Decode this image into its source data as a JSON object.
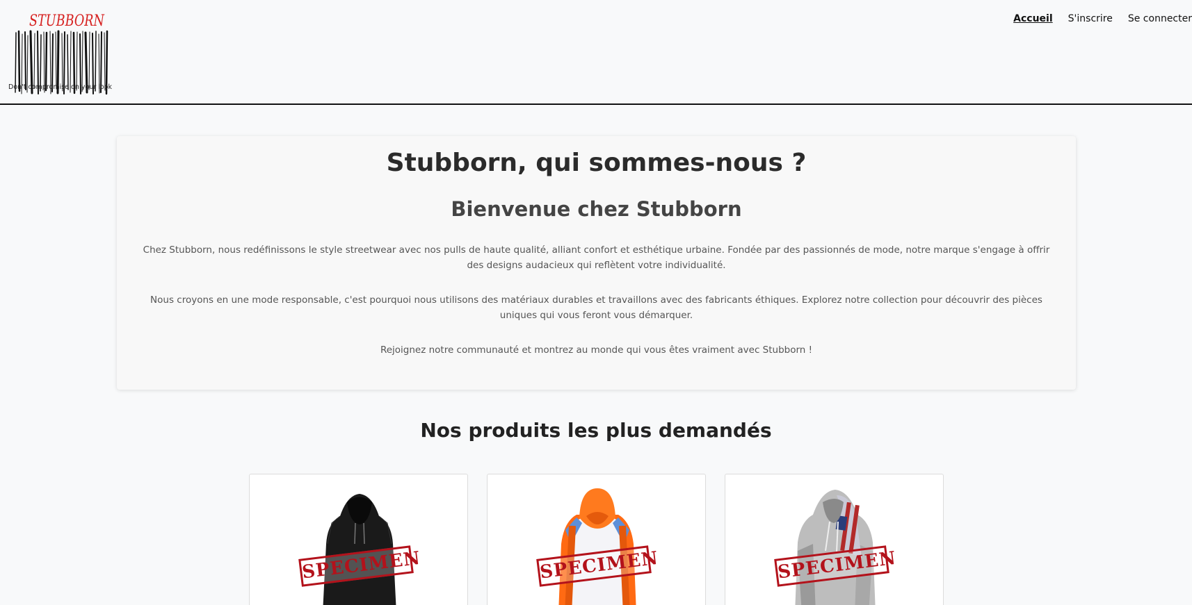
{
  "header": {
    "logo_text": "STUBBORN",
    "tagline": "Don't compromise on your look",
    "nav": [
      {
        "label": "Accueil",
        "active": true
      },
      {
        "label": "S'inscrire",
        "active": false
      },
      {
        "label": "Se connecter",
        "active": false
      }
    ]
  },
  "about": {
    "title": "Stubborn, qui sommes-nous ?",
    "subtitle": "Bienvenue chez Stubborn",
    "paragraphs": [
      "Chez Stubborn, nous redéfinissons le style streetwear avec nos pulls de haute qualité, alliant confort et esthétique urbaine. Fondée par des passionnés de mode, notre marque s'engage à offrir des designs audacieux qui reflètent votre individualité.",
      "Nous croyons en une mode responsable, c'est pourquoi nous utilisons des matériaux durables et travaillons avec des fabricants éthiques. Explorez notre collection pour découvrir des pièces uniques qui vous feront vous démarquer.",
      "Rejoignez notre communauté et montrez au monde qui vous êtes vraiment avec Stubborn !"
    ]
  },
  "products": {
    "title": "Nos produits les plus demandés",
    "items": [
      {
        "image_icon": "black-hoodie-image",
        "stamp": "SPECIMEN"
      },
      {
        "image_icon": "orange-hoodie-image",
        "stamp": "SPECIMEN"
      },
      {
        "image_icon": "grey-flag-hoodie-image",
        "stamp": "SPECIMEN"
      }
    ]
  },
  "colors": {
    "brand_red": "#d6201f",
    "stamp_red": "#b3121b",
    "background": "#f8f9fa"
  }
}
